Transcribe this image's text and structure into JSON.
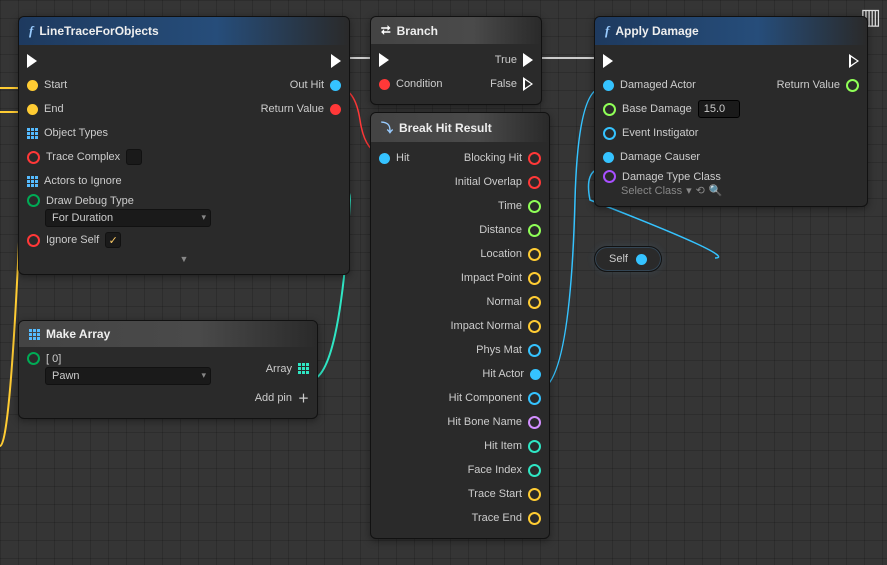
{
  "nodes": {
    "line": {
      "title": "LineTraceForObjects",
      "start": "Start",
      "end": "End",
      "objTypes": "Object Types",
      "traceComplex": "Trace Complex",
      "actorsIgnore": "Actors to Ignore",
      "drawDebug": "Draw Debug Type",
      "drawDebugVal": "For Duration",
      "ignoreSelf": "Ignore Self",
      "outHit": "Out Hit",
      "retVal": "Return Value"
    },
    "branch": {
      "title": "Branch",
      "cond": "Condition",
      "true": "True",
      "false": "False"
    },
    "break": {
      "title": "Break Hit Result",
      "hit": "Hit",
      "blocking": "Blocking Hit",
      "initOverlap": "Initial Overlap",
      "time": "Time",
      "distance": "Distance",
      "location": "Location",
      "impactPoint": "Impact Point",
      "normal": "Normal",
      "impactNormal": "Impact Normal",
      "physMat": "Phys Mat",
      "hitActor": "Hit Actor",
      "hitComp": "Hit Component",
      "hitBone": "Hit Bone Name",
      "hitItem": "Hit Item",
      "faceIndex": "Face Index",
      "traceStart": "Trace Start",
      "traceEnd": "Trace End"
    },
    "apply": {
      "title": "Apply Damage",
      "damagedActor": "Damaged Actor",
      "baseDamage": "Base Damage",
      "baseDamageVal": "15.0",
      "eventInst": "Event Instigator",
      "damageCauser": "Damage Causer",
      "damageType": "Damage Type Class",
      "damageTypeVal": "Select Class",
      "retVal": "Return Value"
    },
    "makeArr": {
      "title": "Make Array",
      "idx": "[ 0]",
      "idxVal": "Pawn",
      "arr": "Array",
      "addPin": "Add pin"
    },
    "self": {
      "label": "Self"
    }
  }
}
